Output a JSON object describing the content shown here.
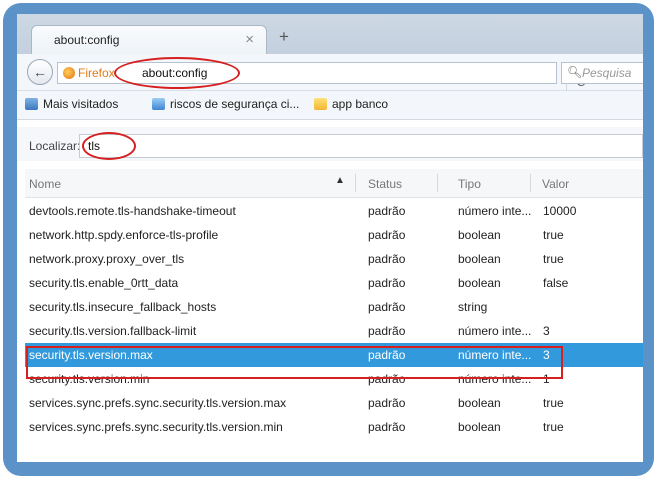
{
  "tab": {
    "title": "about:config",
    "close": "×",
    "new": "+"
  },
  "nav": {
    "back": "←",
    "identity": "Firefox",
    "url": "about:config",
    "reload": "C",
    "search_placeholder": "Pesquisa"
  },
  "bookmarks": [
    {
      "label": "Mais visitados",
      "icon": "most-visited-icon"
    },
    {
      "label": "riscos de segurança ci...",
      "icon": "page-icon"
    },
    {
      "label": "app banco",
      "icon": "folder-icon"
    }
  ],
  "filter": {
    "label": "Localizar:",
    "value": "tls"
  },
  "table": {
    "columns": [
      "Nome",
      "Status",
      "Tipo",
      "Valor"
    ],
    "sort_indicator": "▲",
    "rows": [
      {
        "name": "devtools.remote.tls-handshake-timeout",
        "status": "padrão",
        "type": "número inte...",
        "value": "10000"
      },
      {
        "name": "network.http.spdy.enforce-tls-profile",
        "status": "padrão",
        "type": "boolean",
        "value": "true"
      },
      {
        "name": "network.proxy.proxy_over_tls",
        "status": "padrão",
        "type": "boolean",
        "value": "true"
      },
      {
        "name": "security.tls.enable_0rtt_data",
        "status": "padrão",
        "type": "boolean",
        "value": "false"
      },
      {
        "name": "security.tls.insecure_fallback_hosts",
        "status": "padrão",
        "type": "string",
        "value": ""
      },
      {
        "name": "security.tls.version.fallback-limit",
        "status": "padrão",
        "type": "número inte...",
        "value": "3"
      },
      {
        "name": "security.tls.version.max",
        "status": "padrão",
        "type": "número inte...",
        "value": "3",
        "selected": true
      },
      {
        "name": "security.tls.version.min",
        "status": "padrão",
        "type": "número inte...",
        "value": "1"
      },
      {
        "name": "services.sync.prefs.sync.security.tls.version.max",
        "status": "padrão",
        "type": "boolean",
        "value": "true"
      },
      {
        "name": "services.sync.prefs.sync.security.tls.version.min",
        "status": "padrão",
        "type": "boolean",
        "value": "true"
      }
    ]
  },
  "colors": {
    "frame": "#5b93c8",
    "selection": "#3399dd",
    "annotation": "#d62020"
  }
}
